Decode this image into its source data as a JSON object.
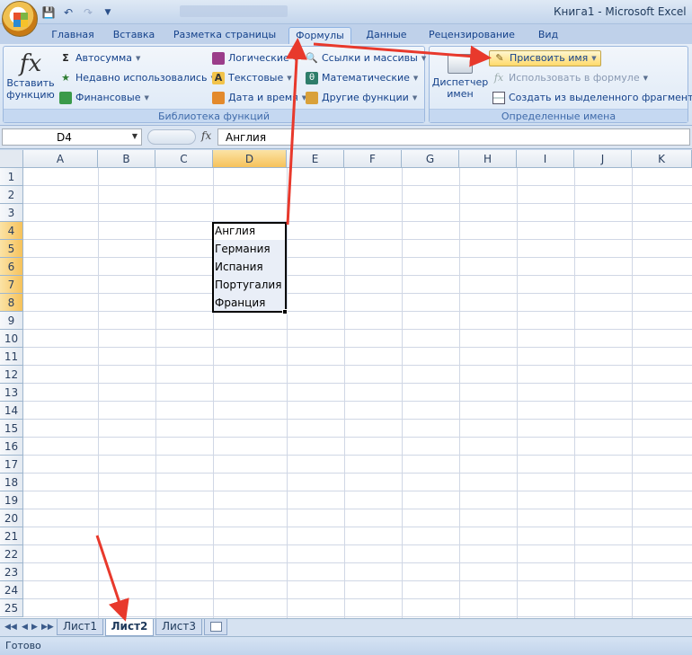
{
  "window": {
    "title": "Книга1 - Microsoft Excel"
  },
  "tabs": [
    "Главная",
    "Вставка",
    "Разметка страницы",
    "Формулы",
    "Данные",
    "Рецензирование",
    "Вид"
  ],
  "active_tab": "Формулы",
  "ribbon": {
    "function_library": {
      "caption": "Библиотека функций",
      "insert_function": [
        "Вставить",
        "функцию"
      ],
      "autosum": "Автосумма",
      "recent": "Недавно использовались",
      "financial": "Финансовые",
      "logical": "Логические",
      "text": "Текстовые",
      "datetime": "Дата и время",
      "lookup": "Ссылки и массивы",
      "math": "Математические",
      "other": "Другие функции"
    },
    "defined_names": {
      "caption": "Определенные имена",
      "name_manager": [
        "Диспетчер",
        "имен"
      ],
      "define_name": "Присвоить имя",
      "use_in_formula": "Использовать в формуле",
      "create_from_selection": "Создать из выделенного фрагмента"
    }
  },
  "formula_bar": {
    "name_box": "D4",
    "fx": "fx",
    "content": "Англия"
  },
  "columns": [
    "A",
    "B",
    "C",
    "D",
    "E",
    "F",
    "G",
    "H",
    "I",
    "J",
    "K"
  ],
  "selected_column": "D",
  "rows": [
    "1",
    "2",
    "3",
    "4",
    "5",
    "6",
    "7",
    "8",
    "9",
    "10",
    "11",
    "12",
    "13",
    "14",
    "15",
    "16",
    "17",
    "18",
    "19",
    "20",
    "21",
    "22",
    "23",
    "24",
    "25"
  ],
  "cells_d": [
    "Англия",
    "Германия",
    "Испания",
    "Португалия",
    "Франция"
  ],
  "sheets": [
    "Лист1",
    "Лист2",
    "Лист3"
  ],
  "active_sheet": "Лист2",
  "status": "Готово",
  "colors": {
    "annotation_arrow": "#e8392c",
    "selection_header": "#f6c25b"
  }
}
